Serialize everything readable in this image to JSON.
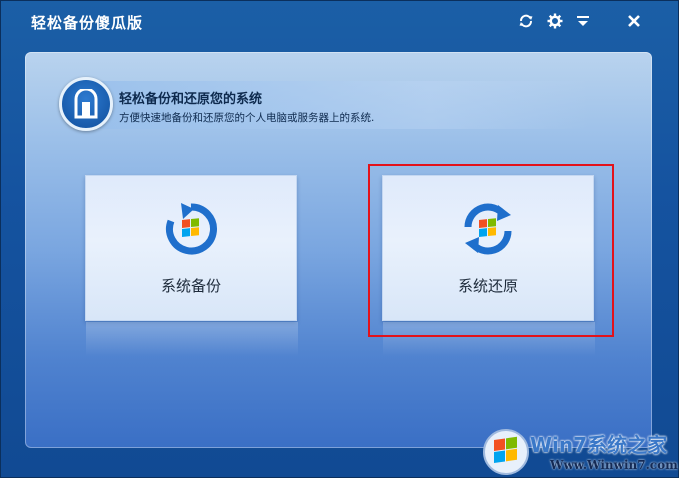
{
  "window": {
    "title": "轻松备份傻瓜版"
  },
  "titlebar_buttons": [
    {
      "name": "refresh",
      "icon": "refresh-icon"
    },
    {
      "name": "settings",
      "icon": "gear-icon"
    },
    {
      "name": "menu",
      "icon": "menu-icon"
    },
    {
      "name": "close",
      "icon": "close-icon"
    }
  ],
  "banner": {
    "title": "轻松备份和还原您的系统",
    "subtitle": "方便快速地备份和还原您的个人电脑或服务器上的系统."
  },
  "actions": {
    "backup_label": "系统备份",
    "restore_label": "系统还原"
  },
  "watermark": {
    "brand": "Win7系统之家",
    "url": "Www.Winwin7.com"
  },
  "colors": {
    "highlight": "#e3121a",
    "accent": "#1553a0"
  }
}
